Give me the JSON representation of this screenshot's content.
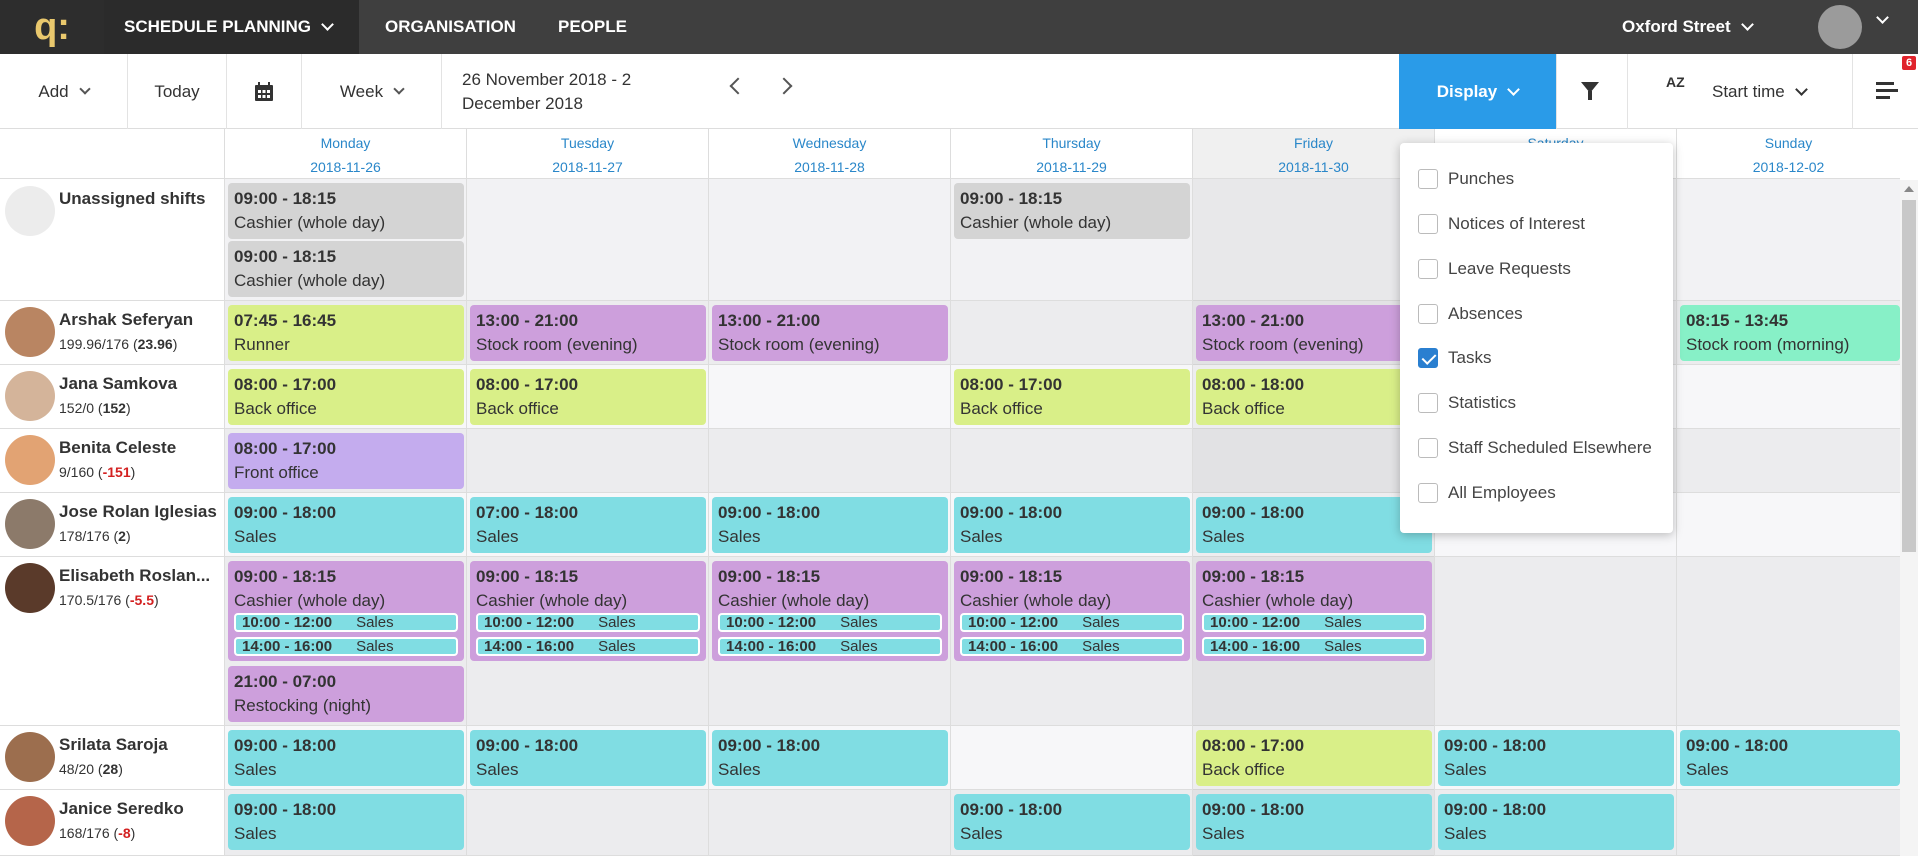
{
  "nav": {
    "logo": "q:",
    "schedule_planning": "SCHEDULE PLANNING",
    "organisation": "ORGANISATION",
    "people": "PEOPLE",
    "location": "Oxford Street"
  },
  "toolbar": {
    "add": "Add",
    "today": "Today",
    "view": "Week",
    "date_range_line1": "26 November 2018 - 2",
    "date_range_line2": "December 2018",
    "display": "Display",
    "sort_icon": "AZ",
    "sort": "Start time",
    "badge": "6"
  },
  "days": [
    {
      "name": "Monday",
      "date": "2018-11-26"
    },
    {
      "name": "Tuesday",
      "date": "2018-11-27"
    },
    {
      "name": "Wednesday",
      "date": "2018-11-28"
    },
    {
      "name": "Thursday",
      "date": "2018-11-29"
    },
    {
      "name": "Friday",
      "date": "2018-11-30"
    },
    {
      "name": "Saturday",
      "date": ""
    },
    {
      "name": "Sunday",
      "date": "2018-12-02"
    }
  ],
  "people": [
    {
      "name": "Unassigned shifts",
      "hours": "",
      "balance": ""
    },
    {
      "name": "Arshak Seferyan",
      "hours": "199.96/176",
      "balance": "23.96"
    },
    {
      "name": "Jana Samkova",
      "hours": "152/0",
      "balance": "152"
    },
    {
      "name": "Benita Celeste",
      "hours": "9/160",
      "balance": "-151"
    },
    {
      "name": "Jose Rolan Iglesias",
      "hours": "178/176",
      "balance": "2"
    },
    {
      "name": "Elisabeth Roslan...",
      "hours": "170.5/176",
      "balance": "-5.5"
    },
    {
      "name": "Srilata Saroja",
      "hours": "48/20",
      "balance": "28"
    },
    {
      "name": "Janice Seredko",
      "hours": "168/176",
      "balance": "-8"
    }
  ],
  "shifts": {
    "unassigned": {
      "time": "09:00 - 18:15",
      "role": "Cashier (whole day)"
    },
    "runner": {
      "time": "07:45 - 16:45",
      "role": "Runner"
    },
    "stock_evening": {
      "time": "13:00 - 21:00",
      "role": "Stock room (evening)"
    },
    "stock_morning": {
      "time": "08:15 - 13:45",
      "role": "Stock room (morning)"
    },
    "back_office": {
      "time": "08:00 - 17:00",
      "role": "Back office"
    },
    "back_office_late": {
      "time": "08:00 - 18:00",
      "role": "Back office"
    },
    "front_office": {
      "time": "08:00 - 17:00",
      "role": "Front office"
    },
    "sales": {
      "time": "09:00 - 18:00",
      "role": "Sales"
    },
    "sales_early": {
      "time": "07:00 - 18:00",
      "role": "Sales"
    },
    "cashier": {
      "time": "09:00 - 18:15",
      "role": "Cashier (whole day)"
    },
    "task1": {
      "time": "10:00 - 12:00",
      "role": "Sales"
    },
    "task2": {
      "time": "14:00 - 16:00",
      "role": "Sales"
    },
    "restock": {
      "time": "21:00 - 07:00",
      "role": "Restocking (night)"
    }
  },
  "display_menu": [
    {
      "label": "Punches",
      "checked": false
    },
    {
      "label": "Notices of Interest",
      "checked": false
    },
    {
      "label": "Leave Requests",
      "checked": false
    },
    {
      "label": "Absences",
      "checked": false
    },
    {
      "label": "Tasks",
      "checked": true
    },
    {
      "label": "Statistics",
      "checked": false
    },
    {
      "label": "Staff Scheduled Elsewhere",
      "checked": false
    },
    {
      "label": "All Employees",
      "checked": false
    }
  ]
}
